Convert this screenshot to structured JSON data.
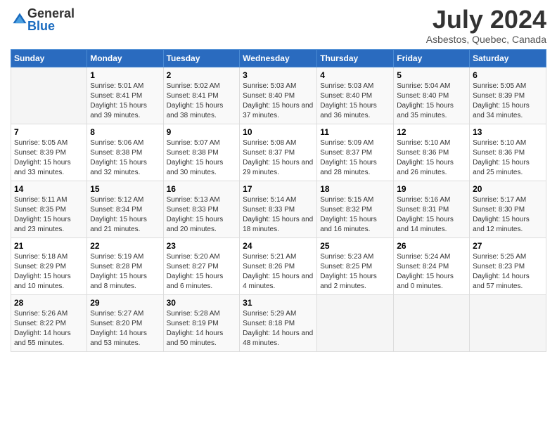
{
  "logo": {
    "general": "General",
    "blue": "Blue"
  },
  "title": "July 2024",
  "subtitle": "Asbestos, Quebec, Canada",
  "days_header": [
    "Sunday",
    "Monday",
    "Tuesday",
    "Wednesday",
    "Thursday",
    "Friday",
    "Saturday"
  ],
  "weeks": [
    [
      {
        "day": "",
        "sunrise": "",
        "sunset": "",
        "daylight": ""
      },
      {
        "day": "1",
        "sunrise": "Sunrise: 5:01 AM",
        "sunset": "Sunset: 8:41 PM",
        "daylight": "Daylight: 15 hours and 39 minutes."
      },
      {
        "day": "2",
        "sunrise": "Sunrise: 5:02 AM",
        "sunset": "Sunset: 8:41 PM",
        "daylight": "Daylight: 15 hours and 38 minutes."
      },
      {
        "day": "3",
        "sunrise": "Sunrise: 5:03 AM",
        "sunset": "Sunset: 8:40 PM",
        "daylight": "Daylight: 15 hours and 37 minutes."
      },
      {
        "day": "4",
        "sunrise": "Sunrise: 5:03 AM",
        "sunset": "Sunset: 8:40 PM",
        "daylight": "Daylight: 15 hours and 36 minutes."
      },
      {
        "day": "5",
        "sunrise": "Sunrise: 5:04 AM",
        "sunset": "Sunset: 8:40 PM",
        "daylight": "Daylight: 15 hours and 35 minutes."
      },
      {
        "day": "6",
        "sunrise": "Sunrise: 5:05 AM",
        "sunset": "Sunset: 8:39 PM",
        "daylight": "Daylight: 15 hours and 34 minutes."
      }
    ],
    [
      {
        "day": "7",
        "sunrise": "Sunrise: 5:05 AM",
        "sunset": "Sunset: 8:39 PM",
        "daylight": "Daylight: 15 hours and 33 minutes."
      },
      {
        "day": "8",
        "sunrise": "Sunrise: 5:06 AM",
        "sunset": "Sunset: 8:38 PM",
        "daylight": "Daylight: 15 hours and 32 minutes."
      },
      {
        "day": "9",
        "sunrise": "Sunrise: 5:07 AM",
        "sunset": "Sunset: 8:38 PM",
        "daylight": "Daylight: 15 hours and 30 minutes."
      },
      {
        "day": "10",
        "sunrise": "Sunrise: 5:08 AM",
        "sunset": "Sunset: 8:37 PM",
        "daylight": "Daylight: 15 hours and 29 minutes."
      },
      {
        "day": "11",
        "sunrise": "Sunrise: 5:09 AM",
        "sunset": "Sunset: 8:37 PM",
        "daylight": "Daylight: 15 hours and 28 minutes."
      },
      {
        "day": "12",
        "sunrise": "Sunrise: 5:10 AM",
        "sunset": "Sunset: 8:36 PM",
        "daylight": "Daylight: 15 hours and 26 minutes."
      },
      {
        "day": "13",
        "sunrise": "Sunrise: 5:10 AM",
        "sunset": "Sunset: 8:36 PM",
        "daylight": "Daylight: 15 hours and 25 minutes."
      }
    ],
    [
      {
        "day": "14",
        "sunrise": "Sunrise: 5:11 AM",
        "sunset": "Sunset: 8:35 PM",
        "daylight": "Daylight: 15 hours and 23 minutes."
      },
      {
        "day": "15",
        "sunrise": "Sunrise: 5:12 AM",
        "sunset": "Sunset: 8:34 PM",
        "daylight": "Daylight: 15 hours and 21 minutes."
      },
      {
        "day": "16",
        "sunrise": "Sunrise: 5:13 AM",
        "sunset": "Sunset: 8:33 PM",
        "daylight": "Daylight: 15 hours and 20 minutes."
      },
      {
        "day": "17",
        "sunrise": "Sunrise: 5:14 AM",
        "sunset": "Sunset: 8:33 PM",
        "daylight": "Daylight: 15 hours and 18 minutes."
      },
      {
        "day": "18",
        "sunrise": "Sunrise: 5:15 AM",
        "sunset": "Sunset: 8:32 PM",
        "daylight": "Daylight: 15 hours and 16 minutes."
      },
      {
        "day": "19",
        "sunrise": "Sunrise: 5:16 AM",
        "sunset": "Sunset: 8:31 PM",
        "daylight": "Daylight: 15 hours and 14 minutes."
      },
      {
        "day": "20",
        "sunrise": "Sunrise: 5:17 AM",
        "sunset": "Sunset: 8:30 PM",
        "daylight": "Daylight: 15 hours and 12 minutes."
      }
    ],
    [
      {
        "day": "21",
        "sunrise": "Sunrise: 5:18 AM",
        "sunset": "Sunset: 8:29 PM",
        "daylight": "Daylight: 15 hours and 10 minutes."
      },
      {
        "day": "22",
        "sunrise": "Sunrise: 5:19 AM",
        "sunset": "Sunset: 8:28 PM",
        "daylight": "Daylight: 15 hours and 8 minutes."
      },
      {
        "day": "23",
        "sunrise": "Sunrise: 5:20 AM",
        "sunset": "Sunset: 8:27 PM",
        "daylight": "Daylight: 15 hours and 6 minutes."
      },
      {
        "day": "24",
        "sunrise": "Sunrise: 5:21 AM",
        "sunset": "Sunset: 8:26 PM",
        "daylight": "Daylight: 15 hours and 4 minutes."
      },
      {
        "day": "25",
        "sunrise": "Sunrise: 5:23 AM",
        "sunset": "Sunset: 8:25 PM",
        "daylight": "Daylight: 15 hours and 2 minutes."
      },
      {
        "day": "26",
        "sunrise": "Sunrise: 5:24 AM",
        "sunset": "Sunset: 8:24 PM",
        "daylight": "Daylight: 15 hours and 0 minutes."
      },
      {
        "day": "27",
        "sunrise": "Sunrise: 5:25 AM",
        "sunset": "Sunset: 8:23 PM",
        "daylight": "Daylight: 14 hours and 57 minutes."
      }
    ],
    [
      {
        "day": "28",
        "sunrise": "Sunrise: 5:26 AM",
        "sunset": "Sunset: 8:22 PM",
        "daylight": "Daylight: 14 hours and 55 minutes."
      },
      {
        "day": "29",
        "sunrise": "Sunrise: 5:27 AM",
        "sunset": "Sunset: 8:20 PM",
        "daylight": "Daylight: 14 hours and 53 minutes."
      },
      {
        "day": "30",
        "sunrise": "Sunrise: 5:28 AM",
        "sunset": "Sunset: 8:19 PM",
        "daylight": "Daylight: 14 hours and 50 minutes."
      },
      {
        "day": "31",
        "sunrise": "Sunrise: 5:29 AM",
        "sunset": "Sunset: 8:18 PM",
        "daylight": "Daylight: 14 hours and 48 minutes."
      },
      {
        "day": "",
        "sunrise": "",
        "sunset": "",
        "daylight": ""
      },
      {
        "day": "",
        "sunrise": "",
        "sunset": "",
        "daylight": ""
      },
      {
        "day": "",
        "sunrise": "",
        "sunset": "",
        "daylight": ""
      }
    ]
  ]
}
